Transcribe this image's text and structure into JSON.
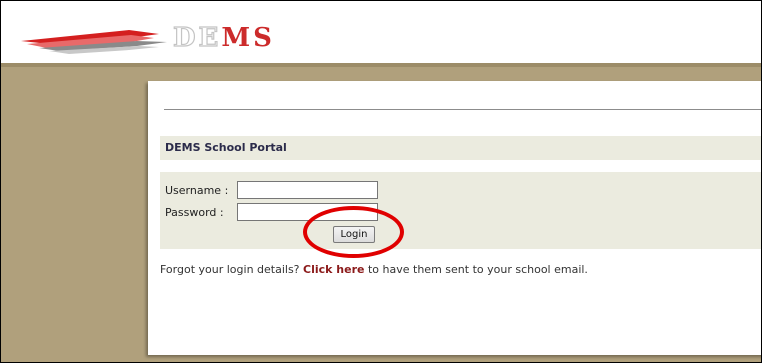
{
  "header": {
    "logo_letters_outline": "DE",
    "logo_letters_solid": "MS"
  },
  "portal": {
    "title": "DEMS School Portal"
  },
  "login": {
    "username_label": "Username :",
    "password_label": "Password :",
    "username_value": "",
    "password_value": "",
    "login_button_label": "Login"
  },
  "forgot": {
    "prefix": "Forgot your login details? ",
    "link_text": "Click here",
    "suffix": " to have them sent to your school email."
  },
  "colors": {
    "brand_red": "#cc2b2b",
    "annotation_red": "#e00000",
    "link_red": "#8b1a1a",
    "page_tan": "#b0a07c",
    "panel_beige": "#ebebdf"
  },
  "icons": {
    "logo": "paper-plane-swoosh-icon"
  },
  "annotation": {
    "shape": "ellipse",
    "target": "login-button"
  }
}
